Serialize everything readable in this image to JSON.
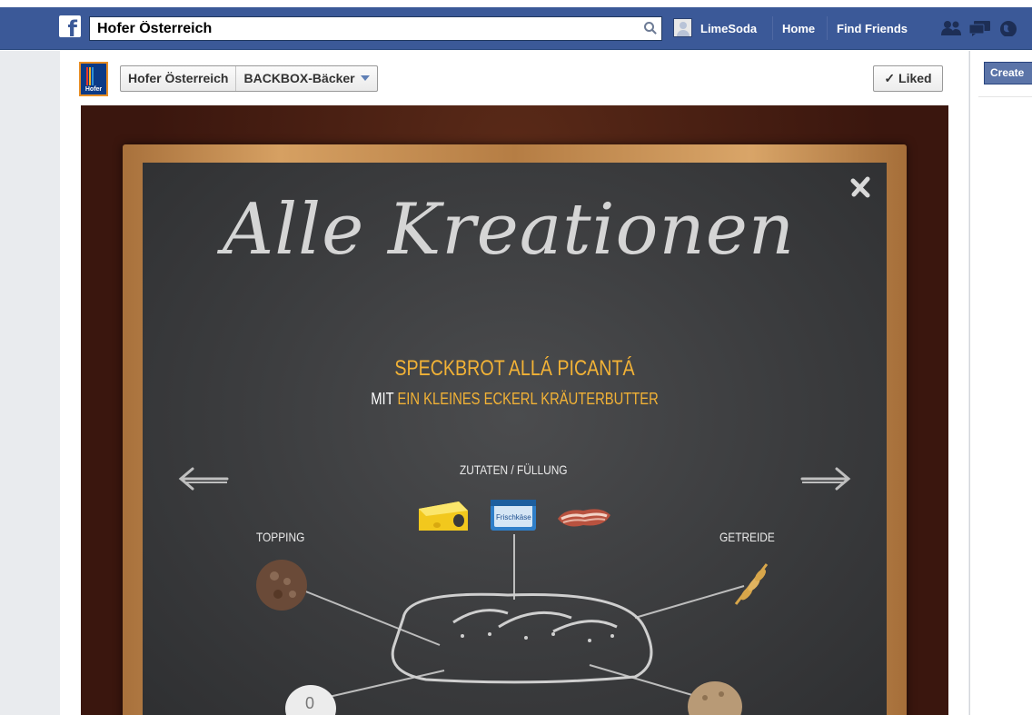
{
  "topbar": {
    "search_value": "Hofer Österreich",
    "user_name": "LimeSoda",
    "nav_home": "Home",
    "nav_find_friends": "Find Friends"
  },
  "sidebar": {
    "create_label": "Create"
  },
  "page_header": {
    "logo_text": "Hofer",
    "crumb_page": "Hofer Österreich",
    "crumb_app": "BACKBOX-Bäcker",
    "liked_label": "✓ Liked"
  },
  "app": {
    "title": "Alle Kreationen",
    "headline": "SPECKBROT ALLÁ PICANTÁ",
    "sub_prefix": "MIT",
    "sub_rest": "EIN KLEINES ECKERL KRÄUTERBUTTER",
    "label_zutaten": "ZUTATEN / FÜLLUNG",
    "label_topping": "TOPPING",
    "label_getreide": "GETREIDE",
    "frischkaese_text": "Frischkäse"
  },
  "colors": {
    "facebook_blue": "#3b5998",
    "accent_yellow": "#f2b236",
    "board": "#3c3d3f",
    "frame_brown": "#3a160e"
  }
}
